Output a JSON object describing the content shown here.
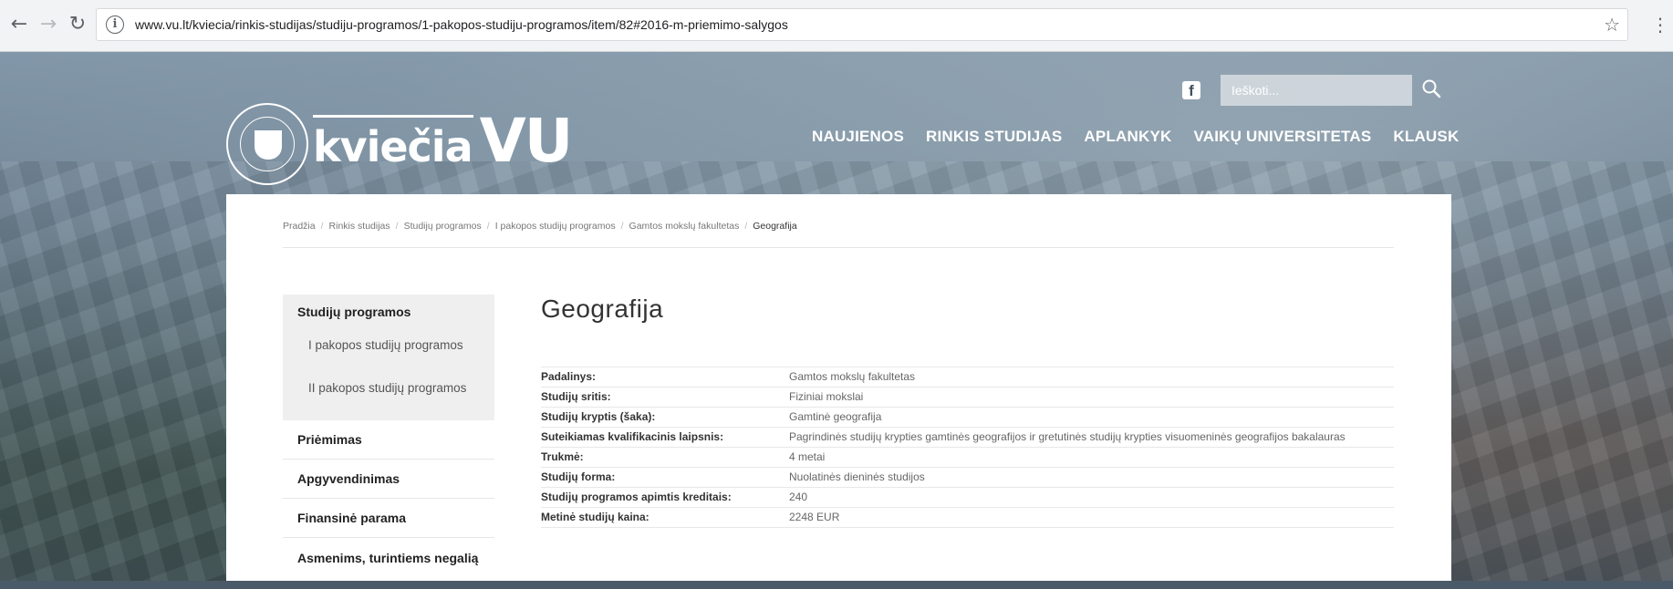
{
  "browser": {
    "url": "www.vu.lt/kviecia/rinkis-studijas/studiju-programos/1-pakopos-studiju-programos/item/82#2016-m-priemimo-salygos",
    "back_icon": "arrow-left-icon",
    "forward_icon": "arrow-right-icon",
    "reload_icon": "reload-icon"
  },
  "header": {
    "logo_small": "kviečia",
    "logo_big": "VU",
    "search_placeholder": "Ieškoti...",
    "nav": [
      "NAUJIENOS",
      "RINKIS STUDIJAS",
      "APLANKYK",
      "VAIKŲ UNIVERSITETAS",
      "KLAUSK"
    ]
  },
  "breadcrumb": [
    "Pradžia",
    "Rinkis studijas",
    "Studijų programos",
    "I pakopos studijų programos",
    "Gamtos mokslų fakultetas",
    "Geografija"
  ],
  "sidebar": {
    "heading": "Studijų programos",
    "sub_items": [
      "I pakopos studijų programos",
      "II pakopos studijų programos"
    ],
    "items": [
      "Priėmimas",
      "Apgyvendinimas",
      "Finansinė parama",
      "Asmenims, turintiems negalią"
    ]
  },
  "main": {
    "title": "Geografija",
    "rows": [
      {
        "key": "Padalinys:",
        "value": "Gamtos mokslų fakultetas"
      },
      {
        "key": "Studijų sritis:",
        "value": "Fiziniai mokslai"
      },
      {
        "key": "Studijų kryptis (šaka):",
        "value": "Gamtinė geografija"
      },
      {
        "key": "Suteikiamas kvalifikacinis laipsnis:",
        "value": "Pagrindinės studijų krypties gamtinės geografijos ir gretutinės studijų krypties visuomeninės geografijos bakalauras"
      },
      {
        "key": "Trukmė:",
        "value": "4 metai"
      },
      {
        "key": "Studijų forma:",
        "value": "Nuolatinės dieninės studijos"
      },
      {
        "key": "Studijų programos apimtis kreditais:",
        "value": "240"
      },
      {
        "key": "Metinė studijų kaina:",
        "value": "2248 EUR"
      }
    ]
  }
}
